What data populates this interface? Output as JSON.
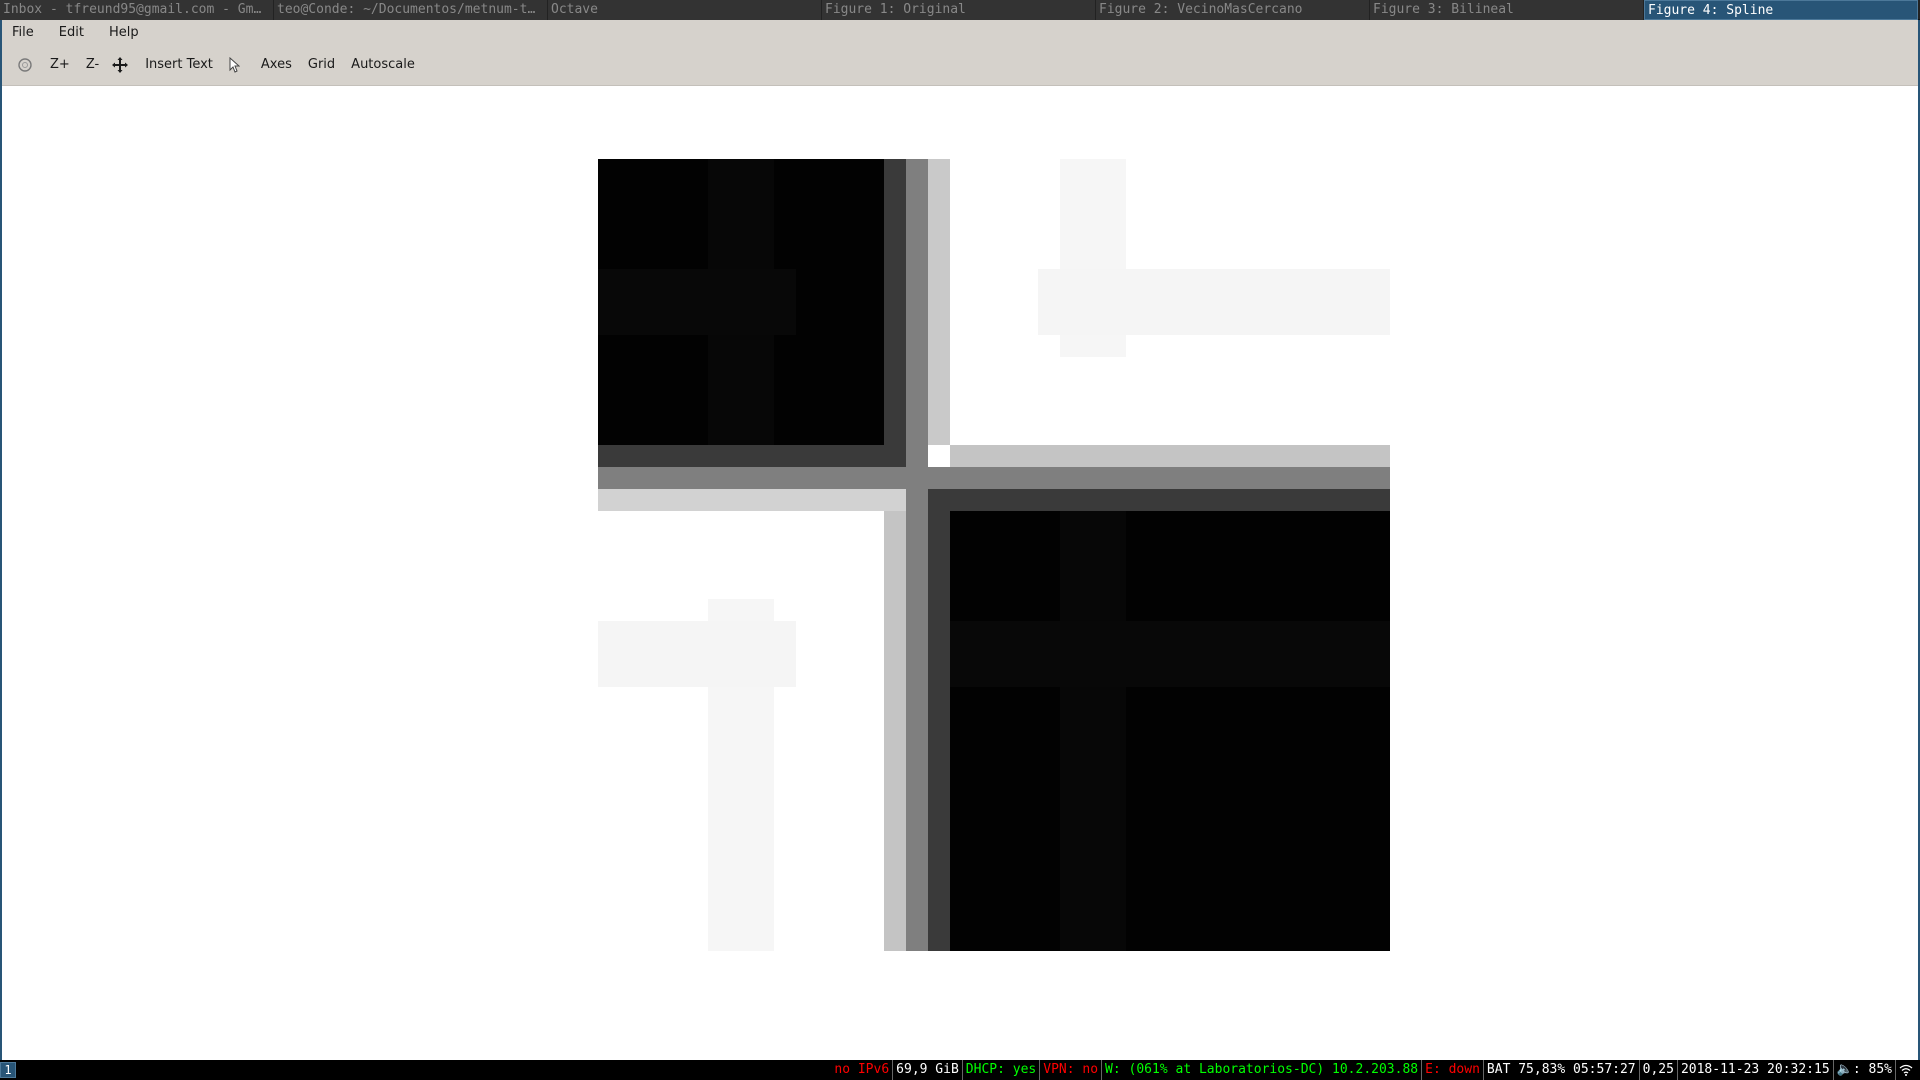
{
  "tabs": [
    {
      "title": "Inbox - tfreund95@gmail.com - Gm…",
      "active": false
    },
    {
      "title": "teo@Conde: ~/Documentos/metnum-t…",
      "active": false
    },
    {
      "title": "Octave",
      "active": false
    },
    {
      "title": "Figure 1: Original",
      "active": false
    },
    {
      "title": "Figure 2: VecinoMasCercano",
      "active": false
    },
    {
      "title": "Figure 3: Bilineal",
      "active": false
    },
    {
      "title": "Figure 4: Spline",
      "active": true
    }
  ],
  "menubar": [
    "File",
    "Edit",
    "Help"
  ],
  "toolbar": {
    "rotate_icon": "rotate-icon",
    "zoom_in": "Z+",
    "zoom_out": "Z-",
    "pan_icon": "pan-icon",
    "insert_text": "Insert Text",
    "select_icon": "pointer-icon",
    "axes": "Axes",
    "grid": "Grid",
    "autoscale": "Autoscale"
  },
  "statusbar": {
    "workspace": "1",
    "segments": [
      {
        "text": "no IPv6",
        "color": "#ff0000"
      },
      {
        "text": "69,9 GiB",
        "color": "#ffffff"
      },
      {
        "text": "DHCP: yes",
        "color": "#00ff00"
      },
      {
        "text": "VPN: no",
        "color": "#ff0000"
      },
      {
        "text": "W: (061% at Laboratorios-DC) 10.2.203.88",
        "color": "#00ff00"
      },
      {
        "text": "E: down",
        "color": "#ff0000"
      },
      {
        "text": "BAT 75,83% 05:57:27",
        "color": "#ffffff"
      },
      {
        "text": "0,25",
        "color": "#ffffff"
      },
      {
        "text": "2018-11-23 20:32:15",
        "color": "#ffffff"
      },
      {
        "text": "🔈: 85%",
        "color": "#ffffff"
      },
      {
        "text": "wifi-icon",
        "color": "#ffffff"
      }
    ]
  },
  "colors": {
    "accent": "#285577",
    "toolbar_bg": "#d6d2cc"
  }
}
